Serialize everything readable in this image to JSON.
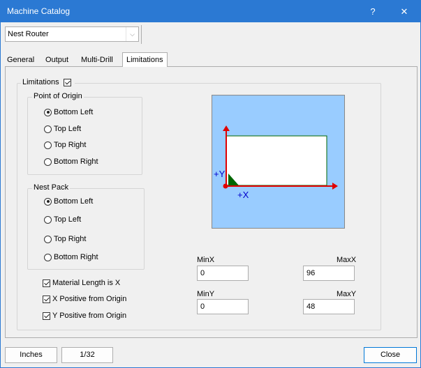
{
  "window": {
    "title": "Machine Catalog",
    "help_label": "?",
    "close_label": "✕"
  },
  "machine": {
    "selected": "Nest Router"
  },
  "tabs": [
    {
      "label": "General"
    },
    {
      "label": "Output"
    },
    {
      "label": "Multi-Drill"
    },
    {
      "label": "Limitations",
      "active": true
    }
  ],
  "limitations": {
    "label": "Limitations",
    "checked": true,
    "origin": {
      "label": "Point of Origin",
      "options": [
        {
          "label": "Bottom Left",
          "checked": true
        },
        {
          "label": "Top Left",
          "checked": false
        },
        {
          "label": "Top Right",
          "checked": false
        },
        {
          "label": "Bottom Right",
          "checked": false
        }
      ]
    },
    "nest_pack": {
      "label": "Nest Pack",
      "options": [
        {
          "label": "Bottom Left",
          "checked": true
        },
        {
          "label": "Top Left",
          "checked": false
        },
        {
          "label": "Top Right",
          "checked": false
        },
        {
          "label": "Bottom Right",
          "checked": false
        }
      ]
    },
    "checks": [
      {
        "label": "Material Length is X",
        "checked": true
      },
      {
        "label": "X Positive from Origin",
        "checked": true
      },
      {
        "label": "Y Positive from Origin",
        "checked": true
      }
    ],
    "preview": {
      "y_label": "+Y",
      "x_label": "+X",
      "background_color": "#99ccff",
      "axis_color": "#e00000",
      "axis_label_color": "#0000cc",
      "corner_color": "#006600"
    },
    "minx": {
      "label": "MinX",
      "value": "0"
    },
    "maxx": {
      "label": "MaxX",
      "value": "96"
    },
    "miny": {
      "label": "MinY",
      "value": "0"
    },
    "maxy": {
      "label": "MaxY",
      "value": "48"
    }
  },
  "footer": {
    "units_label": "Inches",
    "precision_label": "1/32",
    "close_label": "Close"
  },
  "colors": {
    "titlebar": "#2b79d3",
    "accent": "#0078d7"
  }
}
